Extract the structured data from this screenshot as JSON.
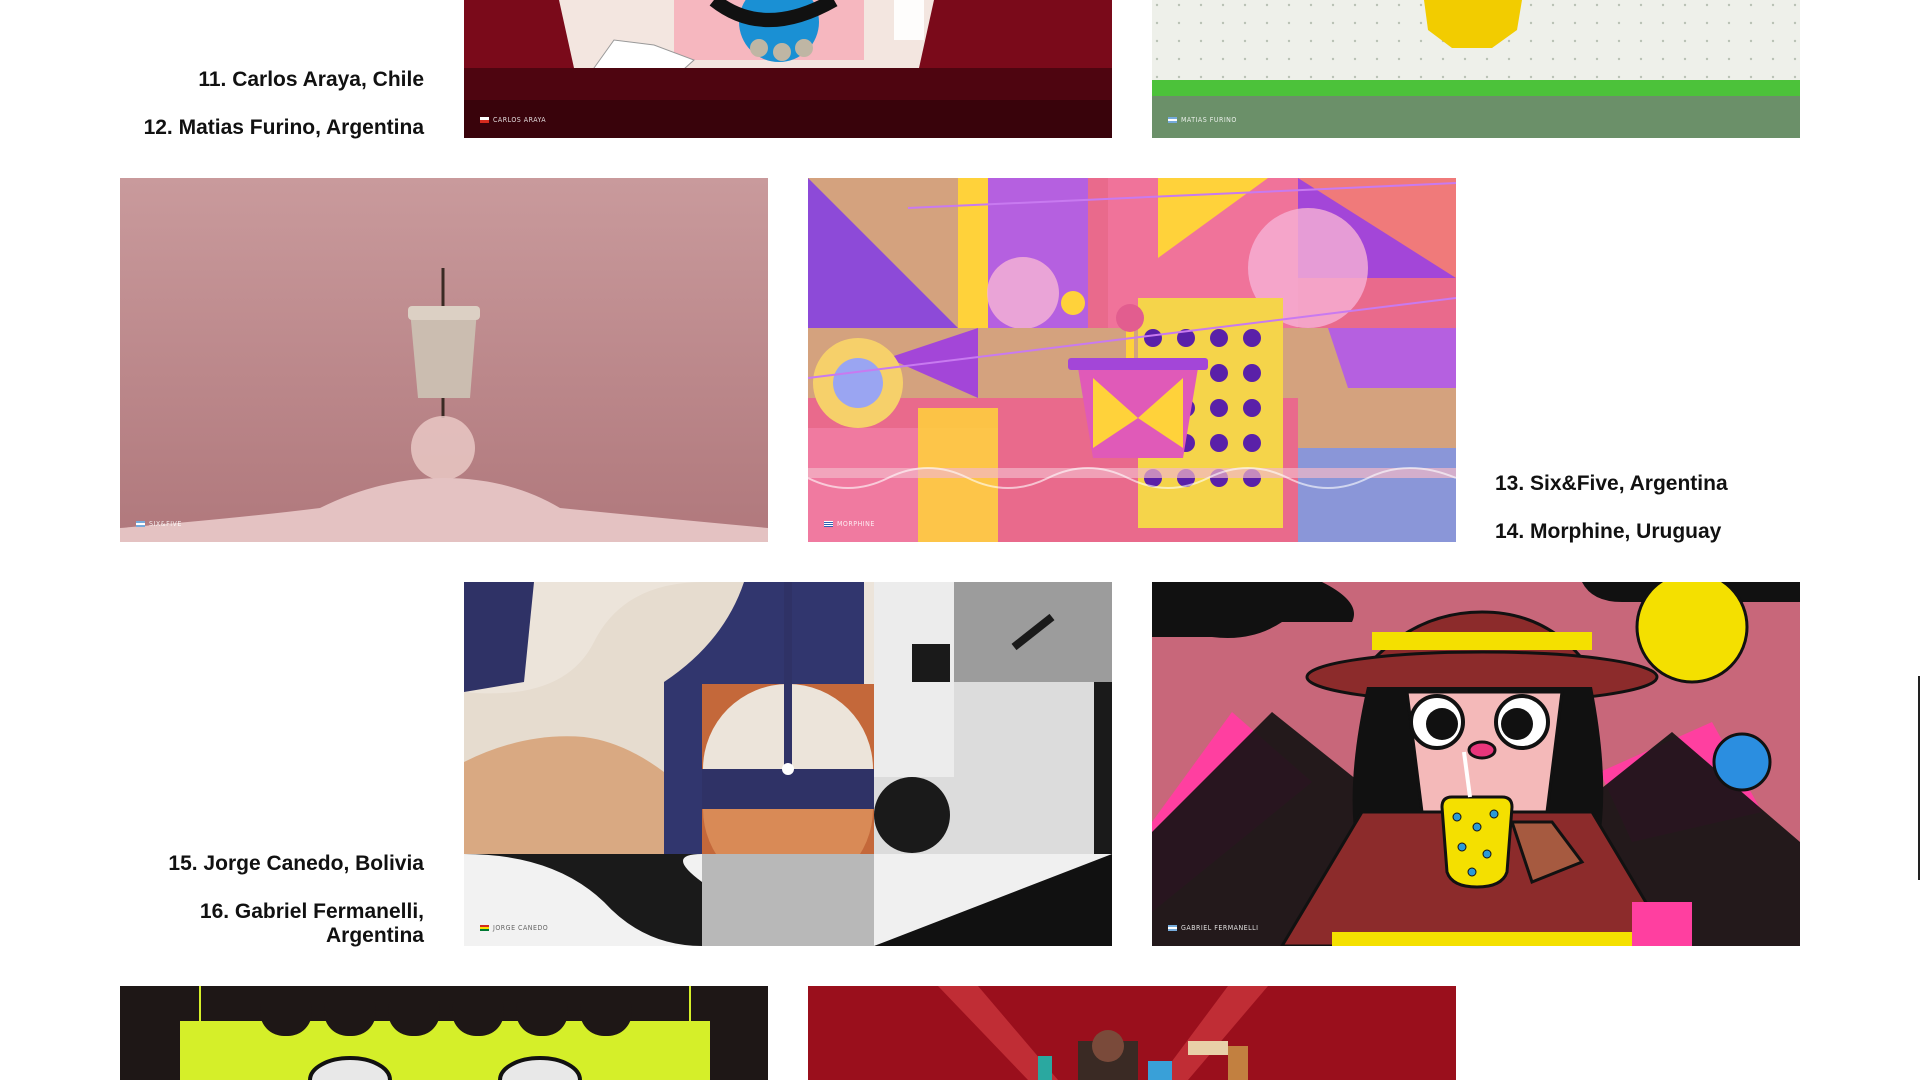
{
  "labels": {
    "l11": "11. Carlos Araya, Chile",
    "l12": "12. Matias Furino, Argentina",
    "l13": "13. Six&Five, Argentina",
    "l14": "14. Morphine, Uruguay",
    "l15": "15. Jorge Canedo, Bolivia",
    "l16a": "16.  Gabriel Fermanelli,",
    "l16b": "Argentina"
  },
  "credits": {
    "carlos": "CARLOS ARAYA",
    "matias": "MATIAS FURINO",
    "sixfive": "SIX&FIVE",
    "morphine": "MORPHINE",
    "jorge": "JORGE CANEDO",
    "gabriel": "GABRIEL FERMANELLI"
  },
  "colors": {
    "text": "#111111",
    "background": "#ffffff"
  }
}
